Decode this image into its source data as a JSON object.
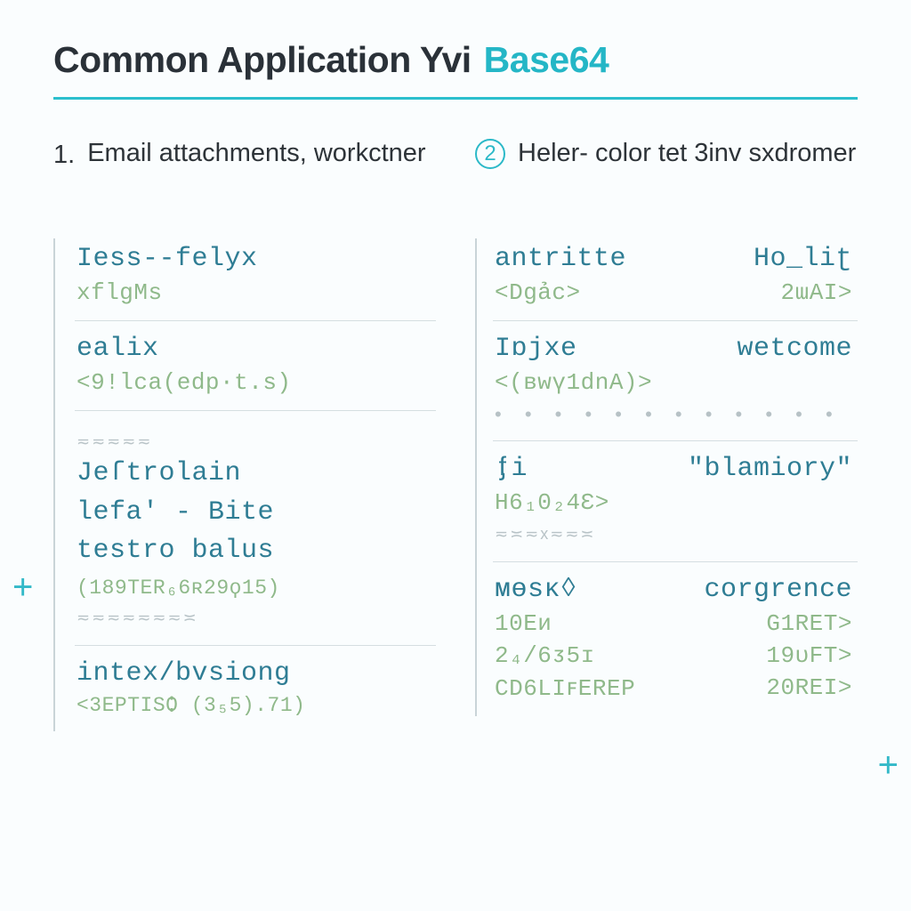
{
  "header": {
    "title_main": "Common Application Yvi",
    "title_accent": "Base64"
  },
  "columns": [
    {
      "marker": "1.",
      "marker_style": "plain",
      "heading": "Email attachments, workctner",
      "blocks": [
        {
          "type": "pair",
          "title_left": "Iess--felyx",
          "title_right": "",
          "sub": "xflgMs"
        },
        {
          "type": "pair",
          "title_left": "ealix",
          "title_right": "",
          "sub": "<9!lca(edp·t.s)"
        },
        {
          "type": "multi",
          "pre_wave": "≂≂≂≂≂",
          "lines": [
            "Jeſtrolain",
            "lefa' - Bite",
            "testro balus"
          ],
          "sub": "(189TER₆6ʀ29ϙ15)",
          "post_wave": "≂≂≂≂≂≂≂≍"
        },
        {
          "type": "pair",
          "title_left": "intex/bvsiong",
          "title_right": "",
          "sub": "<3EPTISѺ (3₅5).71)"
        }
      ]
    },
    {
      "marker": "2",
      "marker_style": "circle",
      "heading": "Heler- color tet 3inv sxdromer",
      "blocks": [
        {
          "type": "pair",
          "title_left": "antritte",
          "title_right": "Ho_liʈ",
          "sub_left": "<Dgảc>",
          "sub_right": "2ɯAI>"
        },
        {
          "type": "pair",
          "title_left": "Iɒjxe",
          "title_right": "wetcome",
          "sub": "<(вwү1dnA)>",
          "dots": "• • • • • • • • • • • • • • • •"
        },
        {
          "type": "pair",
          "title_left": "ᶂi",
          "title_right": "\"blamiory\"",
          "sub": "H6₁0₂4Ɛ>",
          "post_wave": "≂≍≂х≂≂≍"
        },
        {
          "type": "kvlist",
          "title_left": "ᴍөsᴋ◊",
          "title_right": "corgrence",
          "rows": [
            {
              "l": "10Eᴎ",
              "r": "G1RET>"
            },
            {
              "l": "2₄/6ᴣ5ɪ",
              "r": "19ʋFT>"
            },
            {
              "l": "CD6LIꜰEREP",
              "r": "20REI>"
            }
          ]
        }
      ]
    }
  ],
  "decor": {
    "plus": "+"
  }
}
